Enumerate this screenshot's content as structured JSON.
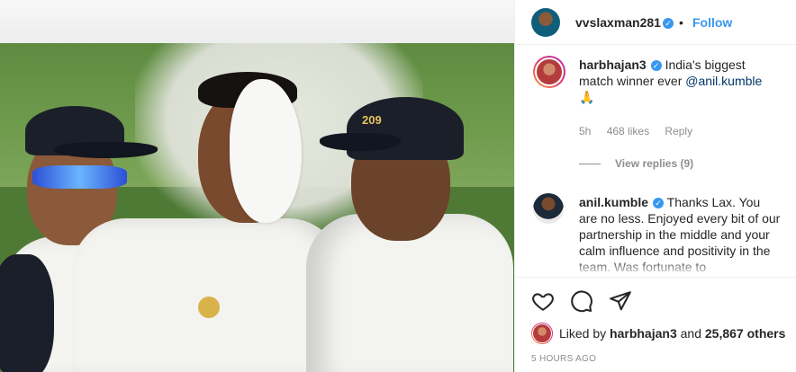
{
  "post": {
    "author": "vvslaxman281",
    "separator": "•",
    "follow_label": "Follow",
    "photo_alt": "Cricket players celebrating on the field",
    "cap_number": "209"
  },
  "comments": [
    {
      "username": "harbhajan3",
      "text": "India's biggest match winner ever",
      "mention": "@anil.kumble",
      "emoji": "🙏",
      "age": "5h",
      "likes": "468 likes",
      "reply_label": "Reply",
      "view_replies": "View replies (9)"
    },
    {
      "username": "anil.kumble",
      "text": "Thanks Lax. You are no less. Enjoyed every bit of our partnership in the middle and your calm influence and positivity in the team. Was fortunate to"
    }
  ],
  "actions": {
    "like_icon": "heart-icon",
    "comment_icon": "comment-icon",
    "share_icon": "share-icon"
  },
  "likes": {
    "prefix": "Liked by",
    "first_user": "harbhajan3",
    "and": "and",
    "others": "25,867 others"
  },
  "timestamp": "5 HOURS AGO",
  "colors": {
    "accent": "#3897f0",
    "text": "#262626",
    "muted": "#8e8e8e",
    "border": "#efefef"
  }
}
